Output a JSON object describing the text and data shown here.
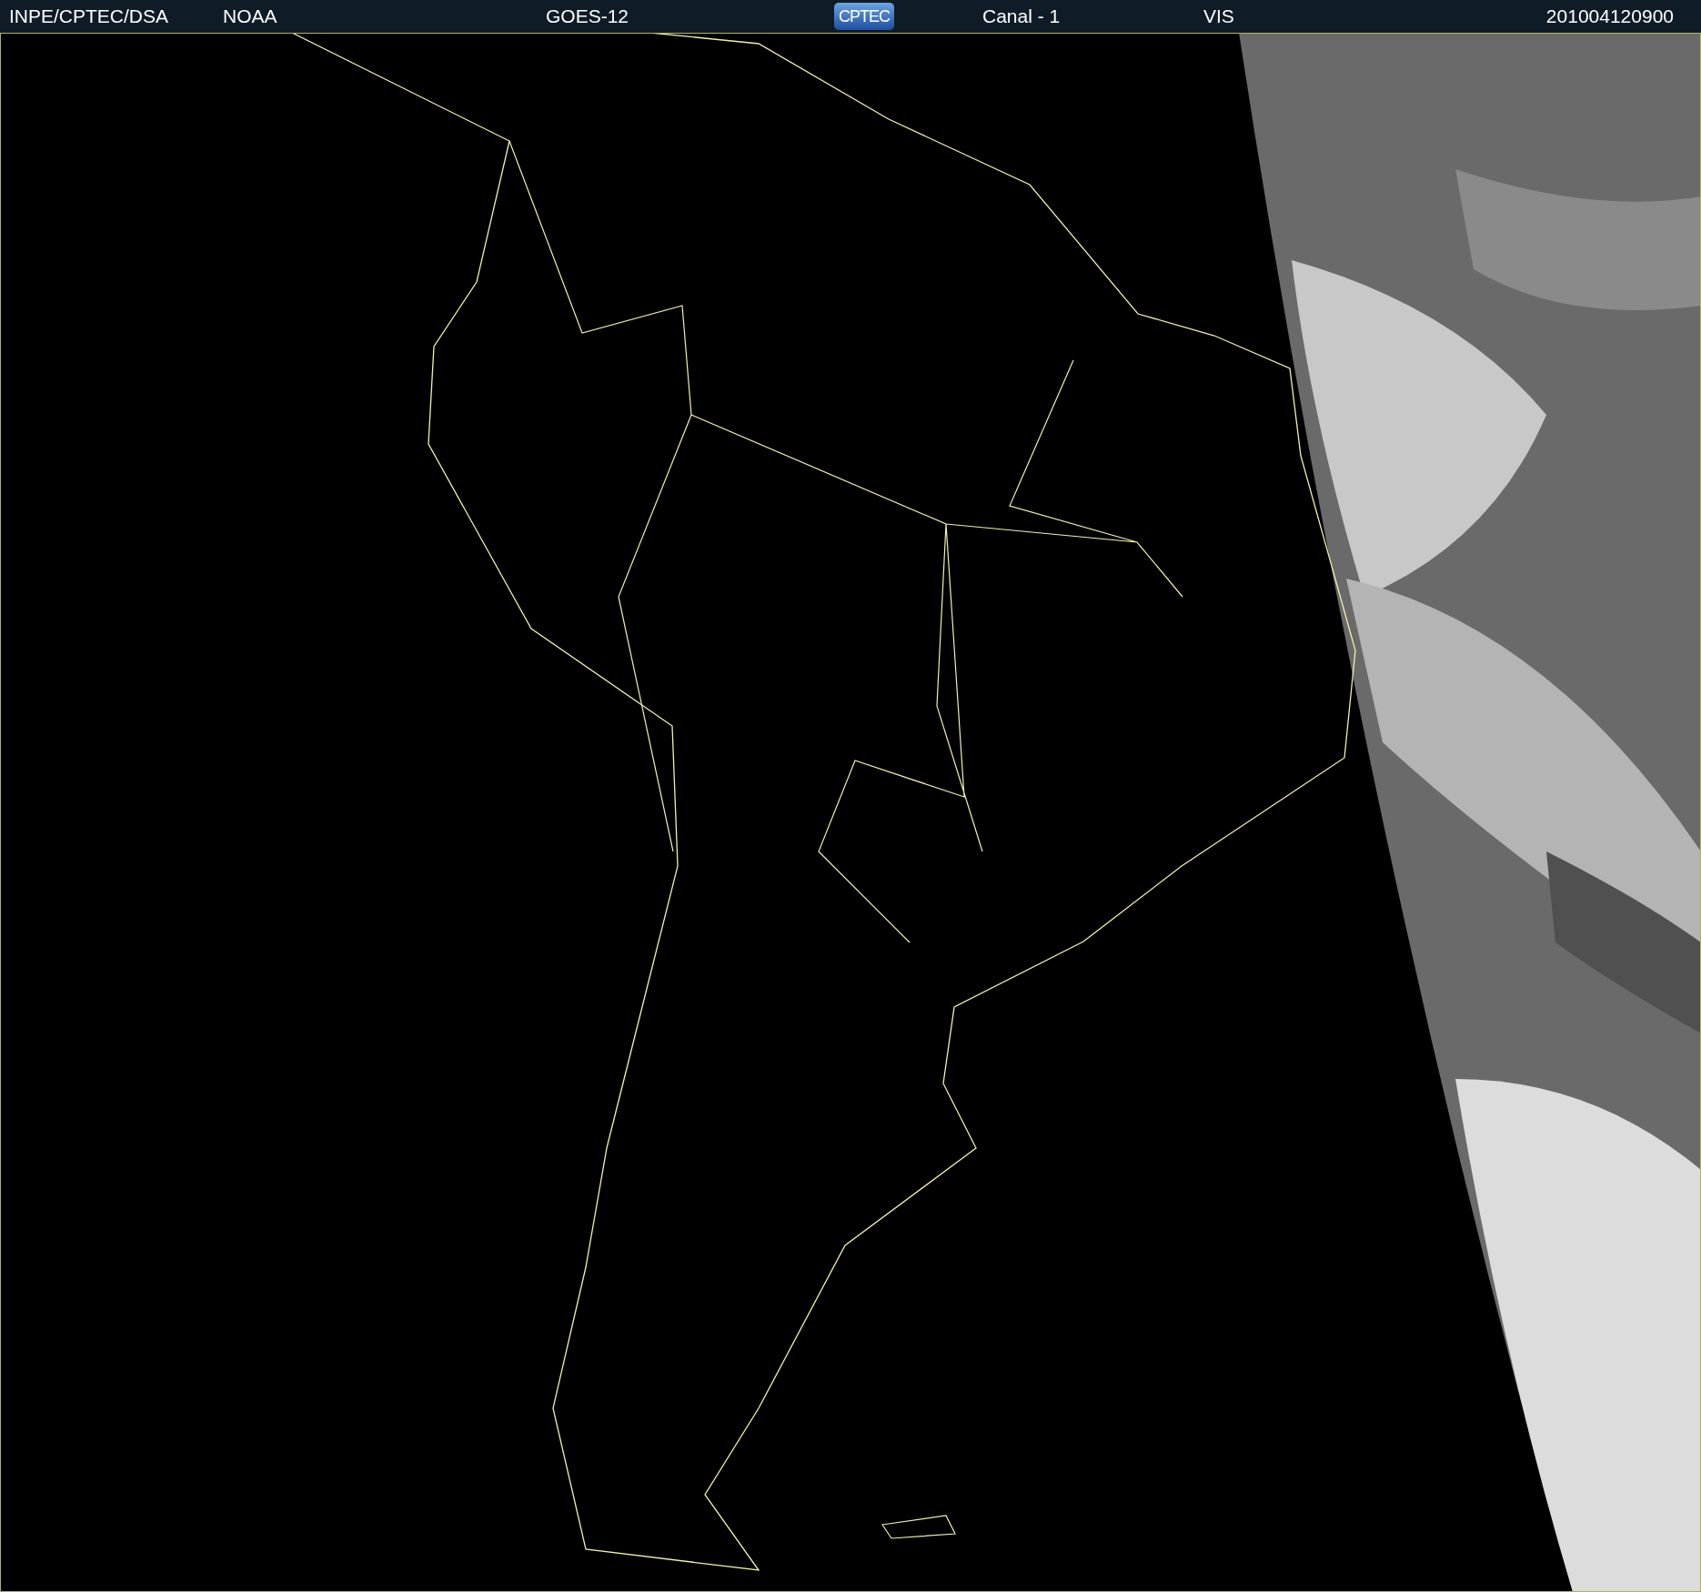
{
  "header": {
    "items": [
      {
        "kind": "text",
        "text": "INPE/CPTEC/DSA"
      },
      {
        "kind": "text",
        "text": "NOAA"
      },
      {
        "kind": "text",
        "text": "GOES-12"
      },
      {
        "kind": "logo",
        "text": "CPTEC"
      },
      {
        "kind": "text",
        "text": "Canal - 1"
      },
      {
        "kind": "text",
        "text": "VIS"
      },
      {
        "kind": "text",
        "text": "201004120900"
      }
    ]
  }
}
